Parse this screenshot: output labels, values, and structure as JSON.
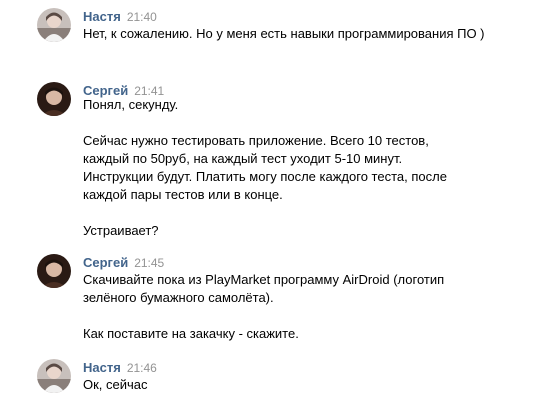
{
  "messages": [
    {
      "author": "Настя",
      "time": "21:40",
      "paragraphs": [
        "Нет, к сожалению. Но у меня есть навыки программирования ПО )"
      ]
    },
    {
      "author": "Сергей",
      "time": "21:41",
      "paragraphs": [
        "Понял, секунду.",
        "Сейчас нужно тестировать приложение. Всего 10 тестов, каждый по 50руб, на каждый тест уходит 5-10 минут. Инструкции будут. Платить могу после каждого теста, после каждой пары тестов или в конце.",
        "Устраивает?"
      ]
    },
    {
      "author": "Сергей",
      "time": "21:45",
      "paragraphs": [
        "Скачивайте пока из PlayMarket программу AirDroid (логотип зелёного бумажного самолёта).",
        "Как поставите на закачку - скажите."
      ]
    },
    {
      "author": "Настя",
      "time": "21:46",
      "paragraphs": [
        "Ок, сейчас"
      ]
    }
  ],
  "colors": {
    "author": "#42648b",
    "time": "#939393",
    "text": "#000000"
  }
}
